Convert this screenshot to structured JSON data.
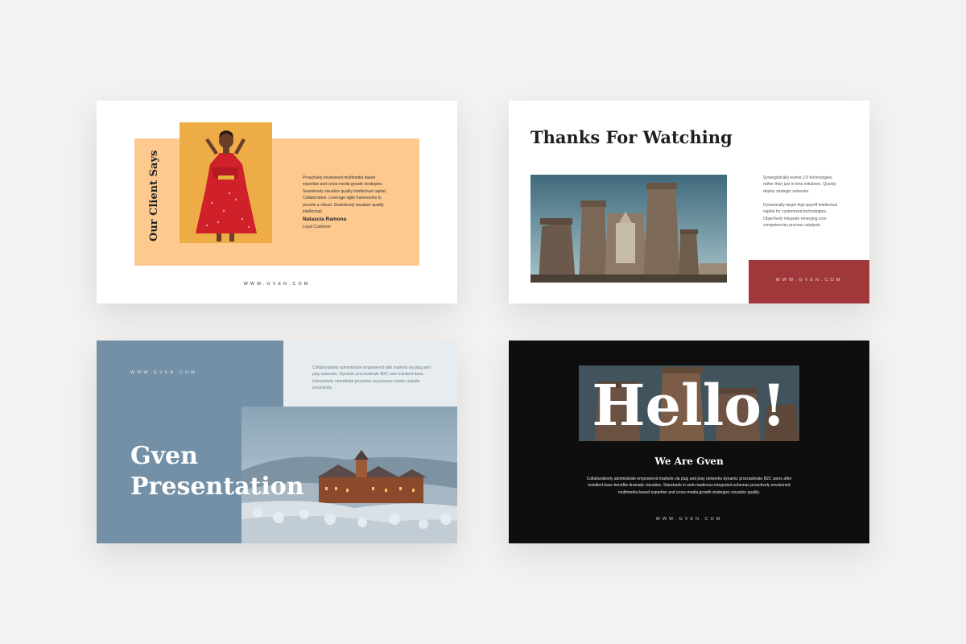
{
  "slide1": {
    "title": "Our Client Says",
    "quote": "Proactively envisioned multimedia based expertise and cross-media growth strategies. Seamlessly visualize quality intellectual capital. Collaboration. Leverage agile frameworks to provide a robust. Seamlessly visualize quality intellectual.",
    "client_name": "Natascia Ramona",
    "client_role": "Loyal Customer",
    "website": "WWW.GVEN.COM"
  },
  "slide2": {
    "title": "Thanks For Watching",
    "paragraph1": "Synergistically evolve 2.0 technologies rather than just in time initiatives. Quickly deploy strategic networks.",
    "paragraph2": "Dynamically target high-payoff intellectual capital for customized technologies. Objectively integrate emerging core competencies process catalysts.",
    "website": "WWW.GVEN.COM"
  },
  "slide3": {
    "website": "WWW.GVEN.COM",
    "description": "Collaboratively administrate empowered with markets via plug and play networks. Dynamic procrastinate B2C user installed base. Interactively coordinate proactive via process centric outside proactively.",
    "title_line1": "Gven",
    "title_line2": "Presentation"
  },
  "slide4": {
    "headline": "Hello!",
    "subtitle": "We Are Gven",
    "description": "Collaboratively administrate empowered markets via plug and play networks dynamic procrastinate B2C users after installed base benefits dramatic visualize. Standards in web-readiness integrated schemas proactively envisioned multimedia based expertise and cross-media growth strategies visualize quality.",
    "website": "WWW.GVEN.COM"
  }
}
